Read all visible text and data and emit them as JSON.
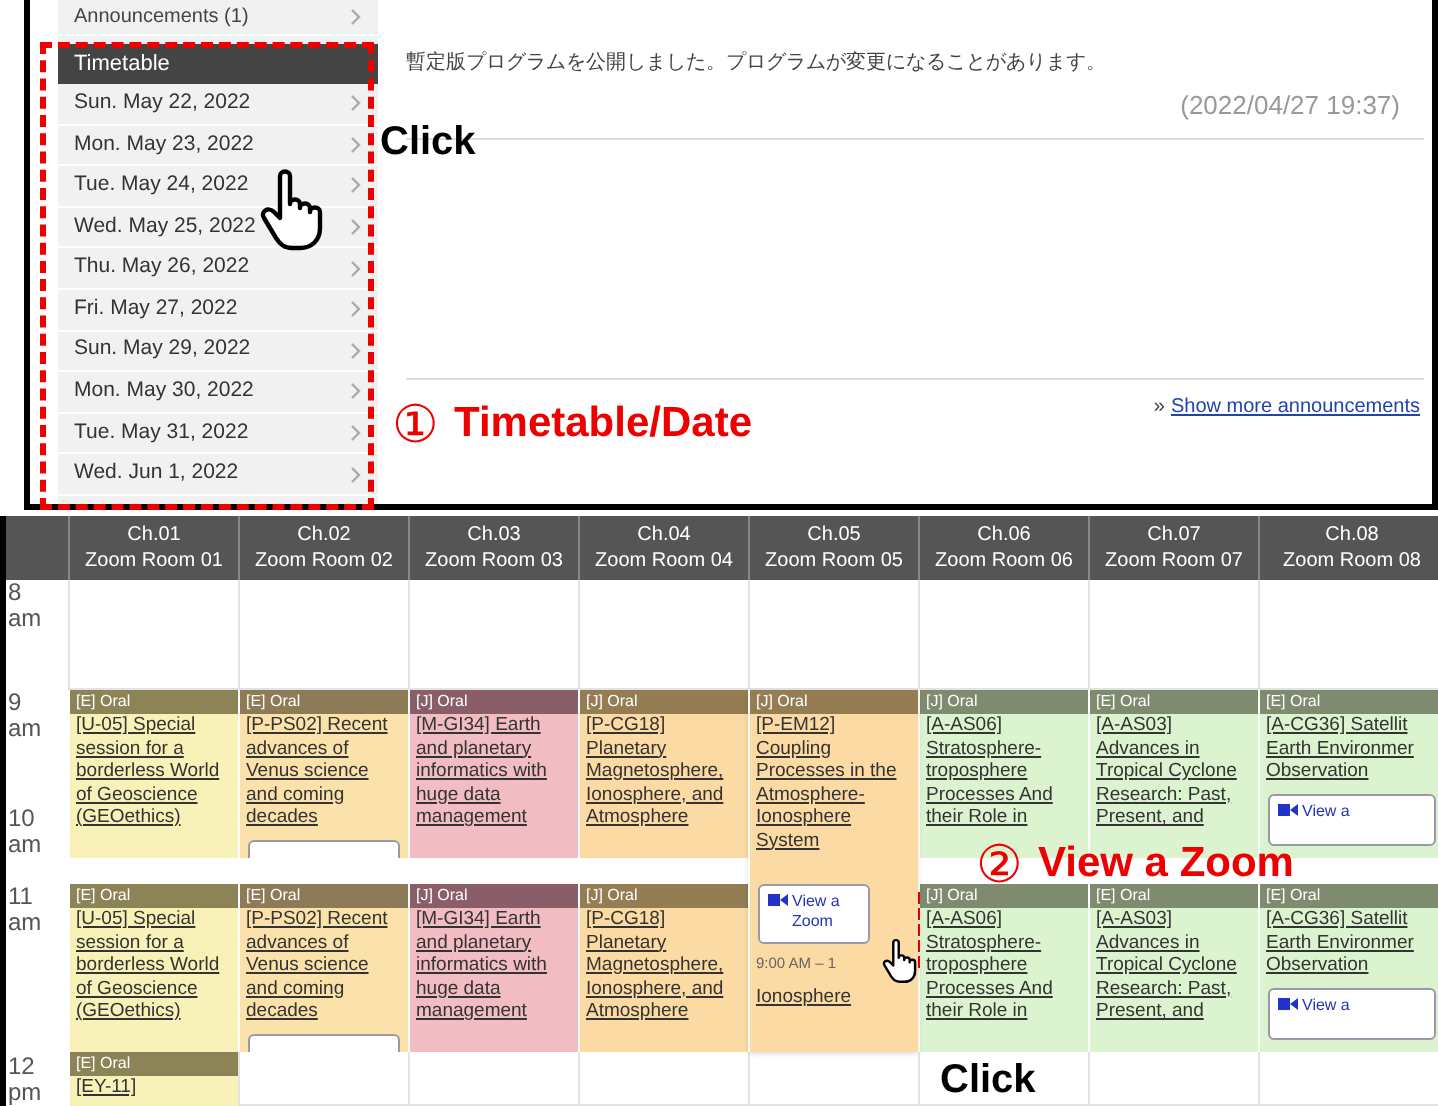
{
  "top_panel": {
    "sidebar": {
      "announcements": "Announcements (1)",
      "title": "Timetable",
      "dates": [
        {
          "label": "Sun. May 22, 2022"
        },
        {
          "label": "Mon. May 23, 2022"
        },
        {
          "label": "Tue. May 24, 2022"
        },
        {
          "label": "Wed. May 25, 2022"
        },
        {
          "label": "Thu. May 26, 2022"
        },
        {
          "label": "Fri. May 27, 2022"
        },
        {
          "label": "Sun. May 29, 2022"
        },
        {
          "label": "Mon. May 30, 2022"
        },
        {
          "label": "Tue. May 31, 2022"
        },
        {
          "label": "Wed. Jun 1, 2022"
        }
      ]
    },
    "announcement": {
      "text": "暫定版プログラムを公開しました。プログラムが変更になることがあります。",
      "time": "(2022/04/27 19:37)"
    },
    "show_more": {
      "marker": "»",
      "link": "Show more announcements"
    }
  },
  "timetable": {
    "hours": [
      {
        "hour": "8",
        "period": "am"
      },
      {
        "hour": "9",
        "period": "am"
      },
      {
        "hour": "10",
        "period": "am"
      },
      {
        "hour": "11",
        "period": "am"
      },
      {
        "hour": "12",
        "period": "pm"
      }
    ],
    "channels": [
      {
        "channel": "Ch.01",
        "room": "Zoom Room 01",
        "sessions": [
          {
            "kind": "card",
            "tag": "[E] Oral",
            "color": "#f8f1b8",
            "title": "[U-05] Special session for a borderless World of Geoscience (GEOethics)"
          },
          {
            "kind": "card",
            "tag": "[E] Oral",
            "color": "#f8f1b8",
            "title": "[U-05] Special session for a borderless World of Geoscience (GEOethics)"
          },
          {
            "kind": "card",
            "tag": "[E] Oral",
            "color": "#f8f1b8",
            "title": "[EY-11]"
          }
        ]
      },
      {
        "channel": "Ch.02",
        "room": "Zoom Room 02",
        "sessions": [
          {
            "kind": "card",
            "tag": "[E] Oral",
            "color": "#fbe1aa",
            "title": "[P-PS02] Recent advances of Venus science and coming decades",
            "zoom_button": {
              "cut": true
            }
          },
          {
            "kind": "card",
            "tag": "[E] Oral",
            "color": "#fbe1aa",
            "title": "[P-PS02] Recent advances of Venus science and coming decades",
            "zoom_button": {
              "cut": true
            }
          }
        ]
      },
      {
        "channel": "Ch.03",
        "room": "Zoom Room 03",
        "sessions": [
          {
            "kind": "card",
            "tag": "[J] Oral",
            "color": "#f2bcc3",
            "title": "[M-GI34] Earth and planetary informatics with huge data management"
          },
          {
            "kind": "card",
            "tag": "[J] Oral",
            "color": "#f2bcc3",
            "title": "[M-GI34] Earth and planetary informatics with huge data management"
          }
        ]
      },
      {
        "channel": "Ch.04",
        "room": "Zoom Room 04",
        "sessions": [
          {
            "kind": "card",
            "tag": "[J] Oral",
            "color": "#fcdaa3",
            "title": "[P-CG18] Planetary Magnetosphere, Ionosphere, and Atmosphere"
          },
          {
            "kind": "card",
            "tag": "[J] Oral",
            "color": "#fcdaa3",
            "title": "[P-CG18] Planetary Magnetosphere, Ionosphere, and Atmosphere"
          }
        ]
      },
      {
        "channel": "Ch.05",
        "room": "Zoom Room 05",
        "sessions": [
          {
            "kind": "expanded",
            "tag": "[J] Oral",
            "color": "#fcdaa3",
            "title": "[P-EM12] Coupling Processes in the Atmosphere-Ionosphere System",
            "zoom_button": {
              "cut": false,
              "label": "View a Zoom"
            },
            "time": "9:00 AM – 1",
            "continued": "Ionosphere"
          }
        ]
      },
      {
        "channel": "Ch.06",
        "room": "Zoom Room 06",
        "sessions": [
          {
            "kind": "card",
            "tag": "[J] Oral",
            "color": "#dcf3cf",
            "title": "[A-AS06] Stratosphere-troposphere Processes And their Role in"
          },
          {
            "kind": "card",
            "tag": "[J] Oral",
            "color": "#dcf3cf",
            "title": "[A-AS06] Stratosphere-troposphere Processes And their Role in"
          }
        ]
      },
      {
        "channel": "Ch.07",
        "room": "Zoom Room 07",
        "sessions": [
          {
            "kind": "card",
            "tag": "[E] Oral",
            "color": "#dcf3cf",
            "title": "[A-AS03] Advances in Tropical Cyclone Research: Past, Present, and"
          },
          {
            "kind": "card",
            "tag": "[E] Oral",
            "color": "#dcf3cf",
            "title": "[A-AS03] Advances in Tropical Cyclone Research: Past, Present, and"
          }
        ]
      },
      {
        "channel": "Ch.08",
        "room": "Zoom Room 08",
        "sessions": [
          {
            "kind": "card",
            "tag": "[E] Oral",
            "color": "#dcf3cf",
            "title": "[A-CG36] Satellit Earth Environmer Observation",
            "zoom_button": {
              "cut": false,
              "label": "View a"
            }
          },
          {
            "kind": "card",
            "tag": "[E] Oral",
            "color": "#dcf3cf",
            "title": "[A-CG36] Satellit Earth Environmer Observation",
            "zoom_button": {
              "cut": false,
              "label": "View a"
            }
          }
        ]
      }
    ]
  },
  "annotations": [
    {
      "kind": "click",
      "label": "Click"
    },
    {
      "kind": "step",
      "number": "①",
      "label": "Timetable/Date"
    },
    {
      "kind": "step",
      "number": "②",
      "label": "View a Zoom"
    },
    {
      "kind": "click",
      "label": "Click"
    }
  ]
}
